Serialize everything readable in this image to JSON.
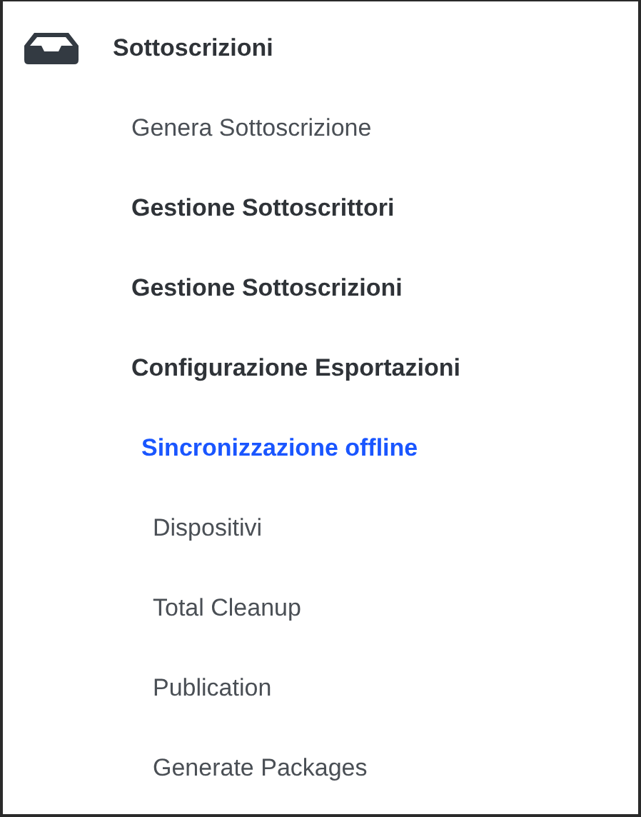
{
  "section": {
    "title": "Sottoscrizioni"
  },
  "items": [
    {
      "label": "Genera Sottoscrizione",
      "kind": "link",
      "selected": false
    },
    {
      "label": "Gestione Sottoscrittori",
      "kind": "group",
      "selected": false
    },
    {
      "label": "Gestione Sottoscrizioni",
      "kind": "group",
      "selected": false
    },
    {
      "label": "Configurazione Esportazioni",
      "kind": "group",
      "selected": false
    },
    {
      "label": "Sincronizzazione offline",
      "kind": "group",
      "selected": true,
      "children": [
        {
          "label": "Dispositivi"
        },
        {
          "label": "Total Cleanup"
        },
        {
          "label": "Publication"
        },
        {
          "label": "Generate Packages"
        }
      ]
    }
  ]
}
